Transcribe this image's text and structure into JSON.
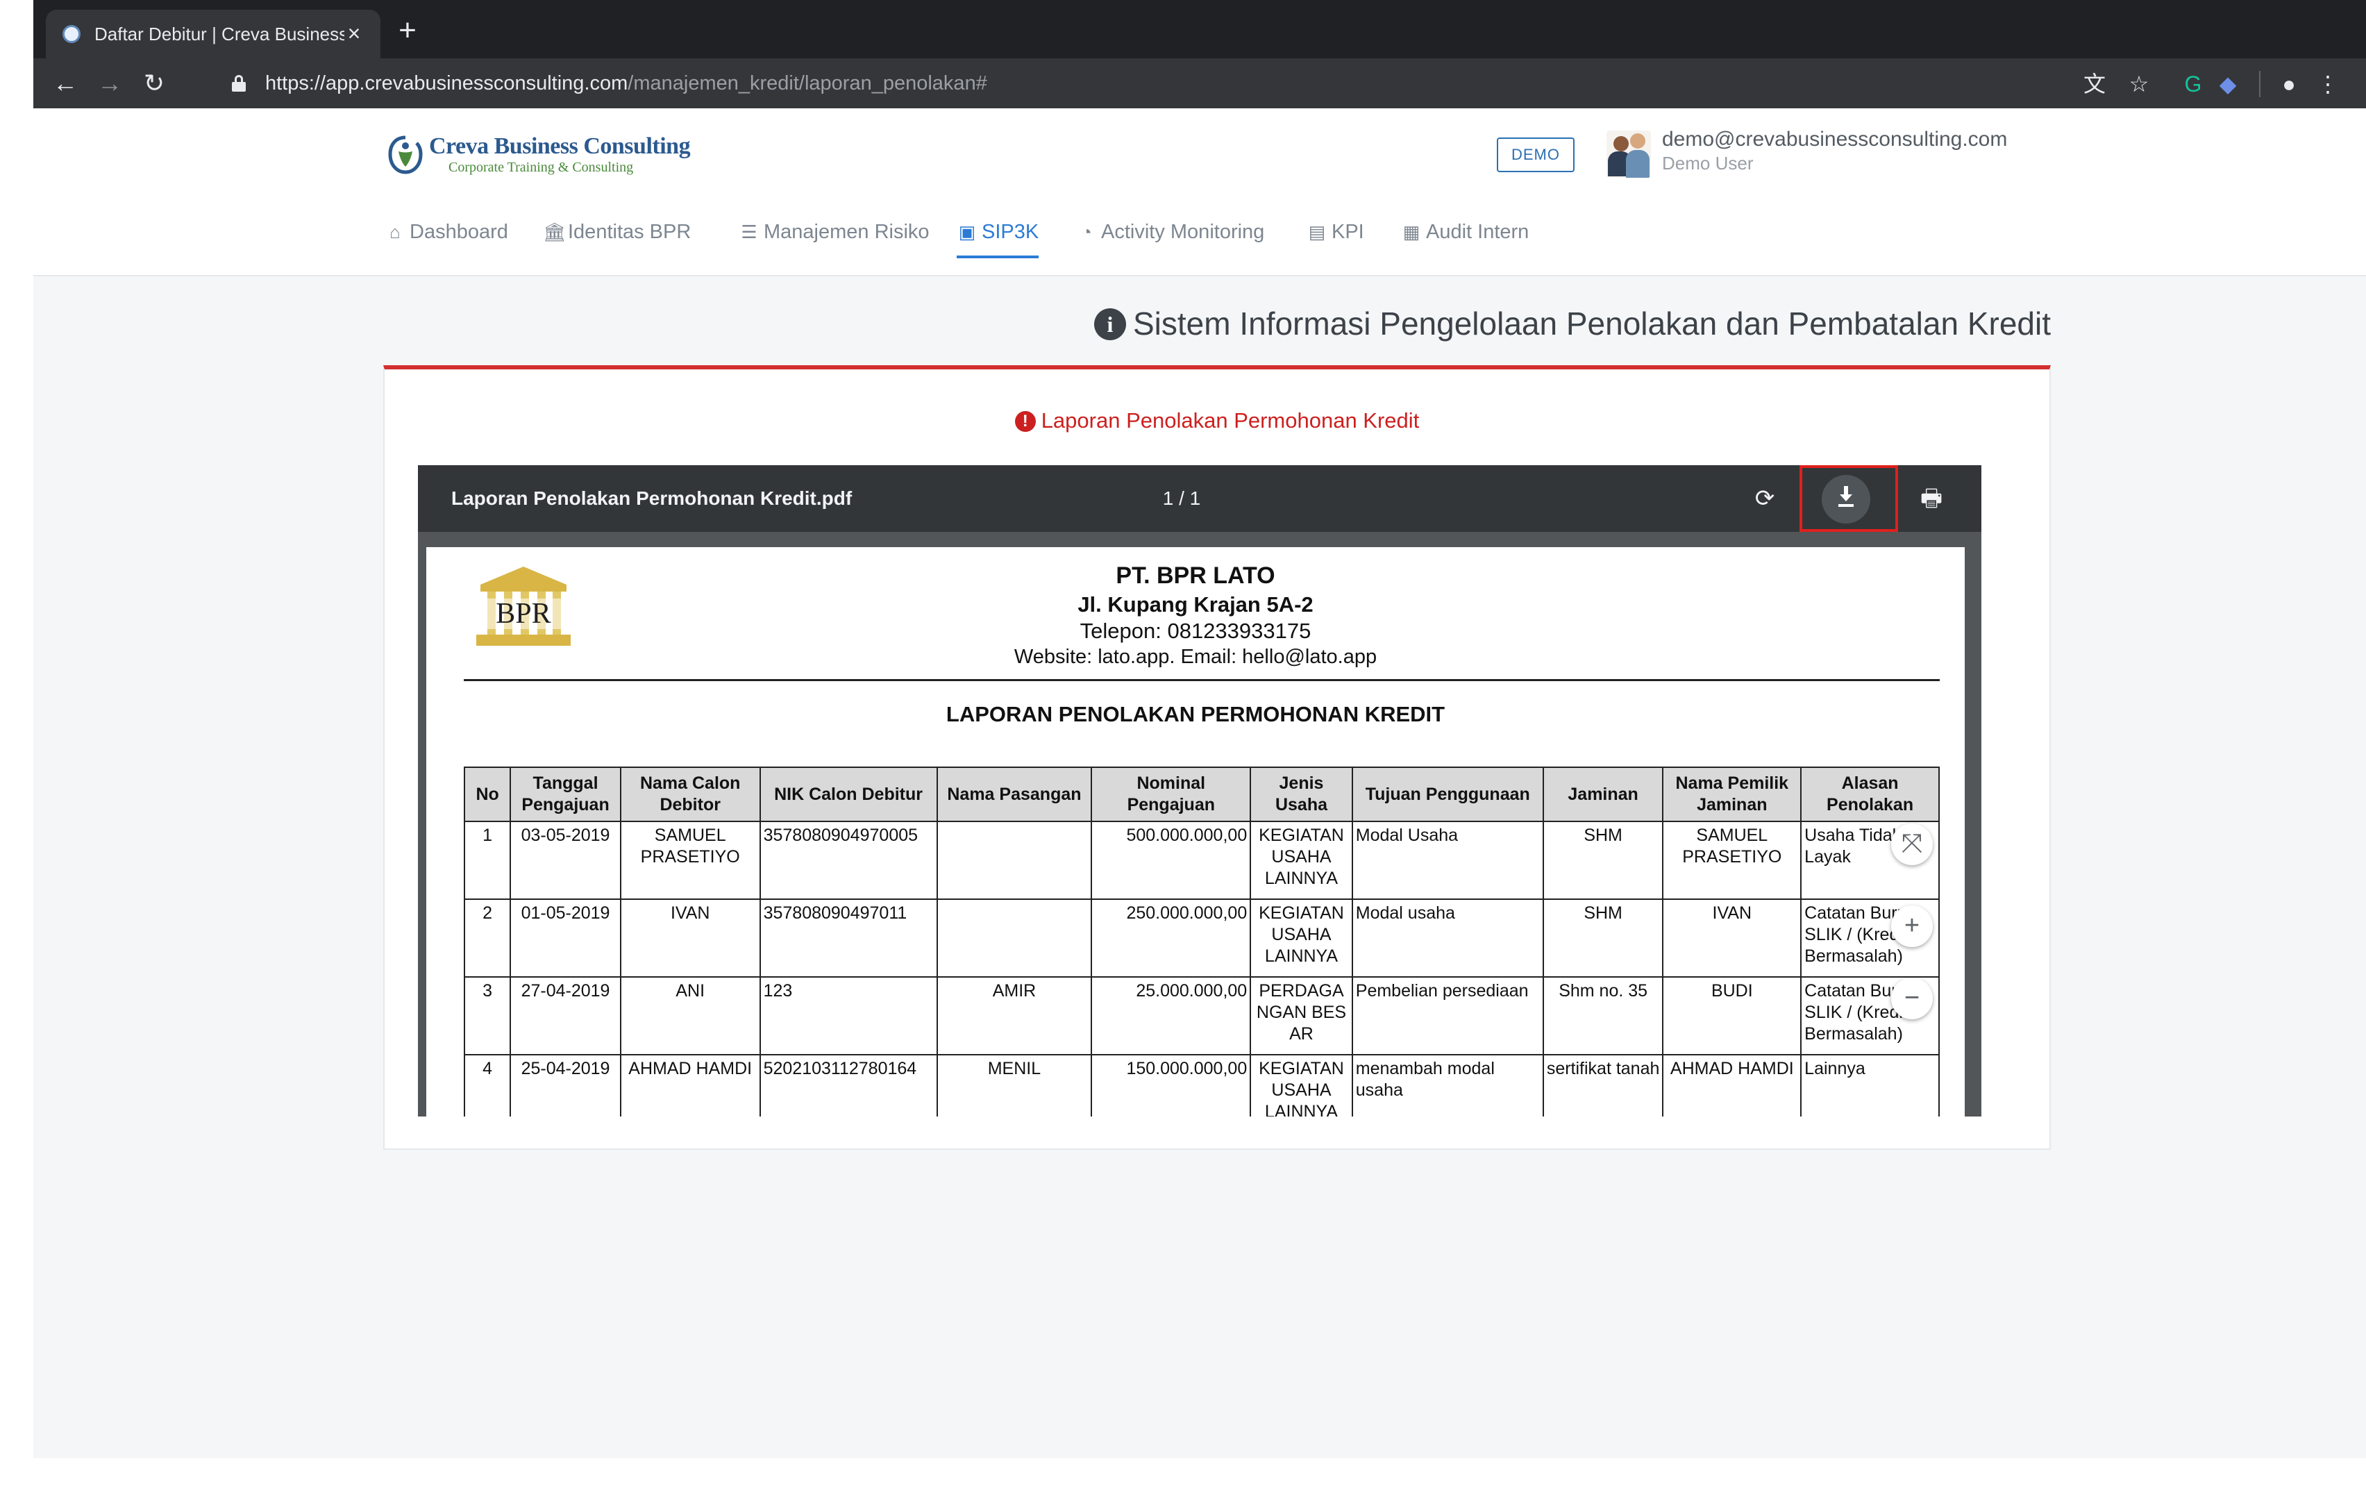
{
  "browser": {
    "tab_title": "Daftar Debitur | Creva Business Consulting",
    "tab_close": "×",
    "new_tab": "+",
    "back": "←",
    "forward": "→",
    "reload": "↻",
    "url_host": "https://app.crevabusinessconsulting.com",
    "url_path": "/manajemen_kredit/laporan_penolakan#",
    "icons": {
      "translate": "文",
      "star": "☆",
      "grammarly": "G",
      "extension": "◆",
      "profile": "●",
      "menu": "⋮"
    }
  },
  "header": {
    "logo_name": "Creva Business Consulting",
    "logo_tagline": "Corporate Training & Consulting",
    "demo_badge": "DEMO",
    "user_email": "demo@crevabusinessconsulting.com",
    "user_role": "Demo User"
  },
  "nav": {
    "items": [
      {
        "label": "Dashboard",
        "icon": "⌂"
      },
      {
        "label": "Identitas BPR",
        "icon": "🏛"
      },
      {
        "label": "Manajemen Risiko",
        "icon": "☰"
      },
      {
        "label": "SIP3K",
        "icon": "▣"
      },
      {
        "label": "Activity Monitoring",
        "icon": "◔"
      },
      {
        "label": "KPI",
        "icon": "▤"
      },
      {
        "label": "Audit Intern",
        "icon": "▦"
      }
    ],
    "active_index": 3,
    "accent_color": "#2b7bd6"
  },
  "page": {
    "title": "Sistem Informasi Pengelolaan Penolakan dan Pembatalan Kredit",
    "card_title": "Laporan Penolakan Permohonan Kredit",
    "accent_color": "#d32f2f"
  },
  "viewer": {
    "file_name": "Laporan Penolakan Permohonan Kredit.pdf",
    "page_indicator": "1 / 1",
    "rotate_icon": "⟳",
    "print_icon": "🖶",
    "zoom": {
      "fit": "⤧",
      "in": "+",
      "out": "−"
    }
  },
  "report": {
    "logo_text": "BPR",
    "company": "PT. BPR LATO",
    "address": "Jl. Kupang Krajan 5A-2",
    "phone": "Telepon: 081233933175",
    "web": "Website: lato.app. Email: hello@lato.app",
    "title": "LAPORAN PENOLAKAN PERMOHONAN KREDIT",
    "columns": [
      "No",
      "Tanggal Pengajuan",
      "Nama Calon Debitor",
      "NIK Calon Debitur",
      "Nama Pasangan",
      "Nominal Pengajuan",
      "Jenis Usaha",
      "Tujuan Penggunaan",
      "Jaminan",
      "Nama Pemilik Jaminan",
      "Alasan Penolakan"
    ],
    "rows": [
      [
        "1",
        "03-05-2019",
        "SAMUEL PRASETIYO",
        "3578080904970005",
        "",
        "500.000.000,00",
        "KEGIATAN USAHA LAINNYA",
        "Modal Usaha",
        "SHM",
        "SAMUEL PRASETIYO",
        "Usaha Tidak Layak"
      ],
      [
        "2",
        "01-05-2019",
        "IVAN",
        "357808090497011",
        "",
        "250.000.000,00",
        "KEGIATAN USAHA LAINNYA",
        "Modal usaha",
        "SHM",
        "IVAN",
        "Catatan Buruk SLIK / (Kredit Bermasalah)"
      ],
      [
        "3",
        "27-04-2019",
        "ANI",
        "123",
        "AMIR",
        "25.000.000,00",
        "PERDAGANGAN BESAR",
        "Pembelian persediaan",
        "Shm no. 35",
        "BUDI",
        "Catatan Buruk SLIK / (Kredit Bermasalah)"
      ],
      [
        "4",
        "25-04-2019",
        "AHMAD HAMDI",
        "5202103112780164",
        "MENIL",
        "150.000.000,00",
        "KEGIATAN USAHA LAINNYA",
        "menambah modal usaha",
        "sertifikat tanah",
        "AHMAD HAMDI",
        "Lainnya"
      ]
    ]
  }
}
